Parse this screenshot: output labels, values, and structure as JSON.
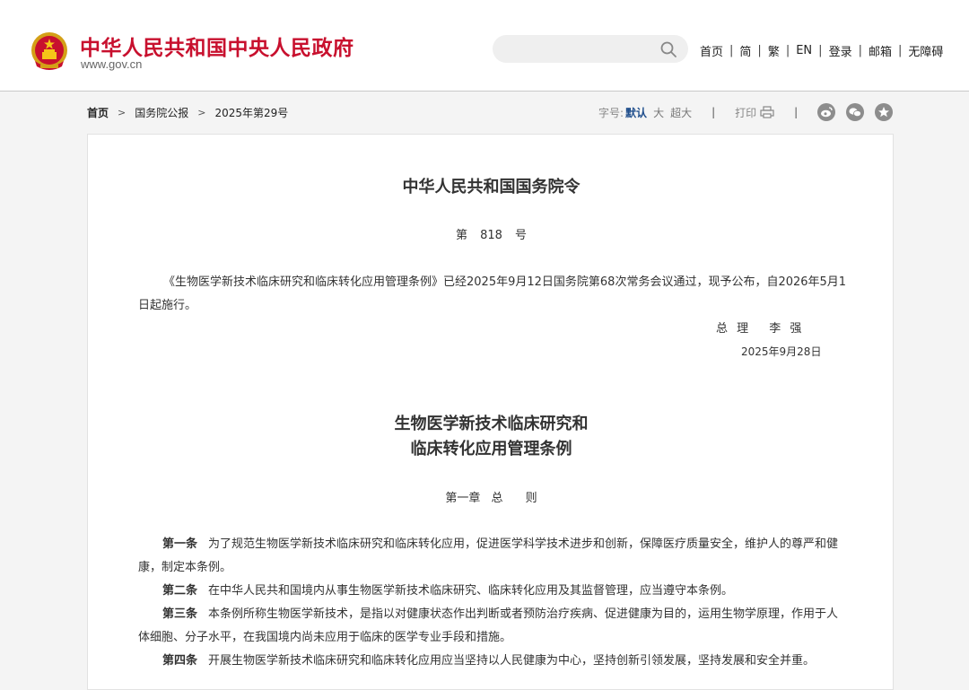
{
  "header": {
    "site_title": "中华人民共和国中央人民政府",
    "site_url": "www.gov.cn",
    "search_placeholder": "",
    "nav": [
      "首页",
      "简",
      "繁",
      "EN",
      "登录",
      "邮箱",
      "无障碍"
    ],
    "brand_color": "#c8102e"
  },
  "breadcrumb": {
    "items": [
      "首页",
      "国务院公报",
      "2025年第29号"
    ]
  },
  "tools": {
    "font_label": "字号:",
    "font_default": "默认",
    "font_large": "大",
    "font_xlarge": "超大",
    "print_label": "打印",
    "share_icons": [
      "weibo-icon",
      "wechat-icon",
      "favorite-icon"
    ]
  },
  "article": {
    "order_title": "中华人民共和国国务院令",
    "order_number": "第 818 号",
    "order_body": "《生物医学新技术临床研究和临床转化应用管理条例》已经2025年9月12日国务院第68次常务会议通过，现予公布，自2026年5月1日起施行。",
    "signer": "总 理　 李 强",
    "sign_date": "2025年9月28日",
    "regulation_title_line1": "生物医学新技术临床研究和",
    "regulation_title_line2": "临床转化应用管理条例",
    "chapter": "第一章 总　 则",
    "clauses": [
      {
        "label": "第一条",
        "text": "为了规范生物医学新技术临床研究和临床转化应用，促进医学科学技术进步和创新，保障医疗质量安全，维护人的尊严和健康，制定本条例。"
      },
      {
        "label": "第二条",
        "text": "在中华人民共和国境内从事生物医学新技术临床研究、临床转化应用及其监督管理，应当遵守本条例。"
      },
      {
        "label": "第三条",
        "text": "本条例所称生物医学新技术，是指以对健康状态作出判断或者预防治疗疾病、促进健康为目的，运用生物学原理，作用于人体细胞、分子水平，在我国境内尚未应用于临床的医学专业手段和措施。"
      },
      {
        "label": "第四条",
        "text": "开展生物医学新技术临床研究和临床转化应用应当坚持以人民健康为中心，坚持创新引领发展，坚持发展和安全并重。"
      }
    ]
  }
}
